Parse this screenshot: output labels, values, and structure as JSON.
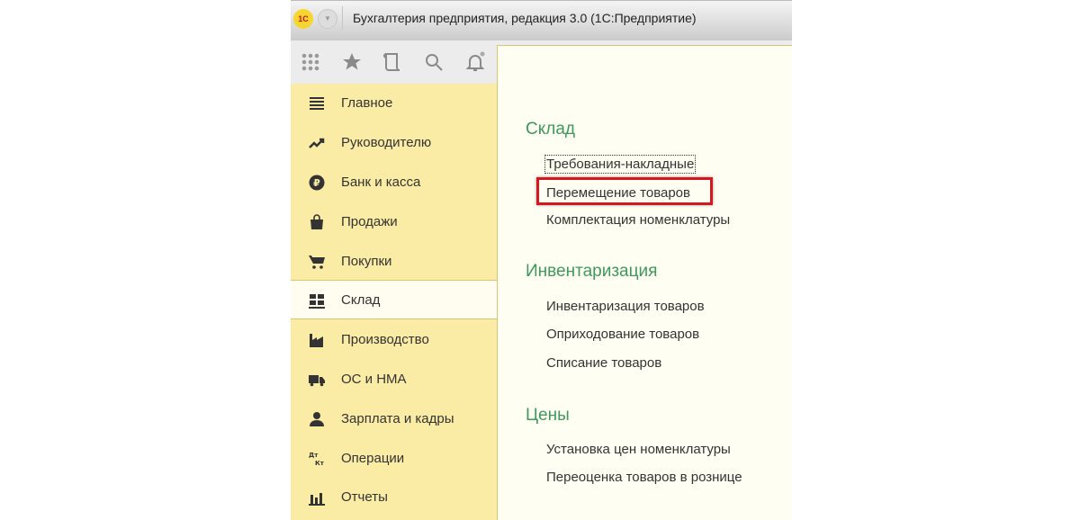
{
  "window": {
    "title": "Бухгалтерия предприятия, редакция 3.0  (1С:Предприятие)",
    "logo_text": "1С"
  },
  "toolbar": {
    "icons": [
      "apps-grid-icon",
      "star-icon",
      "history-icon",
      "search-icon",
      "bell-icon"
    ]
  },
  "sidebar": {
    "items": [
      {
        "label": "Главное",
        "icon": "menu-lines-icon"
      },
      {
        "label": "Руководителю",
        "icon": "trend-icon"
      },
      {
        "label": "Банк и касса",
        "icon": "ruble-icon"
      },
      {
        "label": "Продажи",
        "icon": "bag-icon"
      },
      {
        "label": "Покупки",
        "icon": "cart-icon"
      },
      {
        "label": "Склад",
        "icon": "warehouse-icon",
        "selected": true
      },
      {
        "label": "Производство",
        "icon": "factory-icon"
      },
      {
        "label": "ОС и НМА",
        "icon": "truck-icon"
      },
      {
        "label": "Зарплата и кадры",
        "icon": "person-icon"
      },
      {
        "label": "Операции",
        "icon": "dt-kt-icon",
        "icon_text": [
          "Дт",
          "Кт"
        ]
      },
      {
        "label": "Отчеты",
        "icon": "bar-chart-icon"
      }
    ]
  },
  "content": {
    "sections": [
      {
        "title": "Склад",
        "links": [
          "Требования-накладные",
          "Перемещение товаров",
          "Комплектация номенклатуры"
        ]
      },
      {
        "title": "Инвентаризация",
        "links": [
          "Инвентаризация товаров",
          "Оприходование товаров",
          "Списание товаров"
        ]
      },
      {
        "title": "Цены",
        "links": [
          "Установка цен номенклатуры",
          "Переоценка товаров в рознице"
        ]
      }
    ],
    "highlighted_link": "Перемещение товаров"
  },
  "colors": {
    "sidebar": "#fbeca5",
    "content": "#fffef3",
    "section_title": "#3e9a5c",
    "highlight": "#d6171f"
  }
}
